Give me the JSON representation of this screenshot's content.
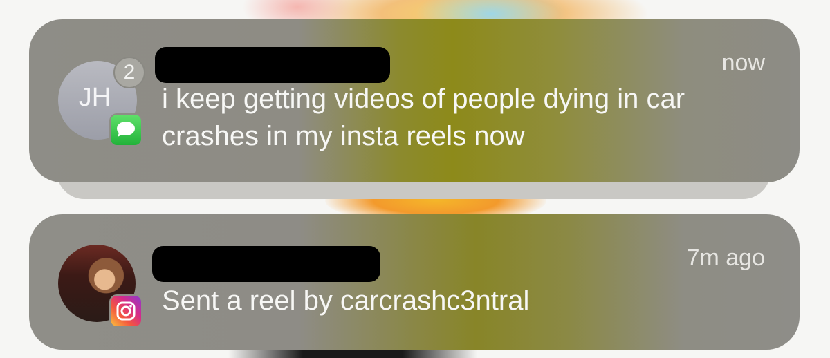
{
  "notifications": [
    {
      "avatar_initials": "JH",
      "badge_count": "2",
      "time": "now",
      "body": "i keep getting videos of people dying in car crashes in my insta reels now",
      "app_icon": "messages-icon"
    },
    {
      "time": "7m ago",
      "body": "Sent a reel by carcrashc3ntral",
      "app_icon": "instagram-icon"
    }
  ]
}
